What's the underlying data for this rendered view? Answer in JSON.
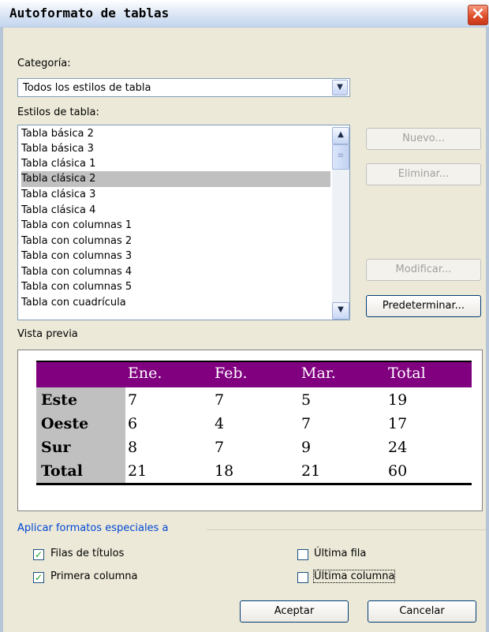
{
  "window": {
    "title": "Autoformato de tablas"
  },
  "categoria": {
    "label": "Categoría:",
    "value": "Todos los estilos de tabla"
  },
  "estilos": {
    "label": "Estilos de tabla:",
    "items": [
      "Tabla básica 2",
      "Tabla básica 3",
      "Tabla clásica 1",
      "Tabla clásica 2",
      "Tabla clásica 3",
      "Tabla clásica 4",
      "Tabla con columnas 1",
      "Tabla con columnas 2",
      "Tabla con columnas 3",
      "Tabla con columnas 4",
      "Tabla con columnas 5",
      "Tabla con cuadrícula"
    ],
    "selected": "Tabla clásica 2"
  },
  "buttons": {
    "nuevo": "Nuevo...",
    "eliminar": "Eliminar...",
    "modificar": "Modificar...",
    "predeterminar": "Predeterminar...",
    "aceptar": "Aceptar",
    "cancelar": "Cancelar"
  },
  "preview": {
    "label": "Vista previa",
    "headers": [
      "",
      "Ene.",
      "Feb.",
      "Mar.",
      "Total"
    ],
    "rows": [
      {
        "label": "Este",
        "values": [
          "7",
          "7",
          "5",
          "19"
        ]
      },
      {
        "label": "Oeste",
        "values": [
          "6",
          "4",
          "7",
          "17"
        ]
      },
      {
        "label": "Sur",
        "values": [
          "8",
          "7",
          "9",
          "24"
        ]
      },
      {
        "label": "Total",
        "values": [
          "21",
          "18",
          "21",
          "60"
        ]
      }
    ],
    "header_color": "#800080",
    "first_column_color": "#c0c0c0"
  },
  "special": {
    "label": "Aplicar formatos especiales a",
    "filas_titulos": {
      "label": "Filas de títulos",
      "checked": true
    },
    "primera_columna": {
      "label": "Primera columna",
      "checked": true
    },
    "ultima_fila": {
      "label": "Última fila",
      "checked": false
    },
    "ultima_columna": {
      "label": "Última columna",
      "checked": false
    }
  },
  "icons": {
    "close": "close-icon",
    "dropdown": "chevron-down-icon",
    "scroll_up": "arrow-up-icon",
    "scroll_down": "arrow-down-icon",
    "check": "check-icon"
  }
}
